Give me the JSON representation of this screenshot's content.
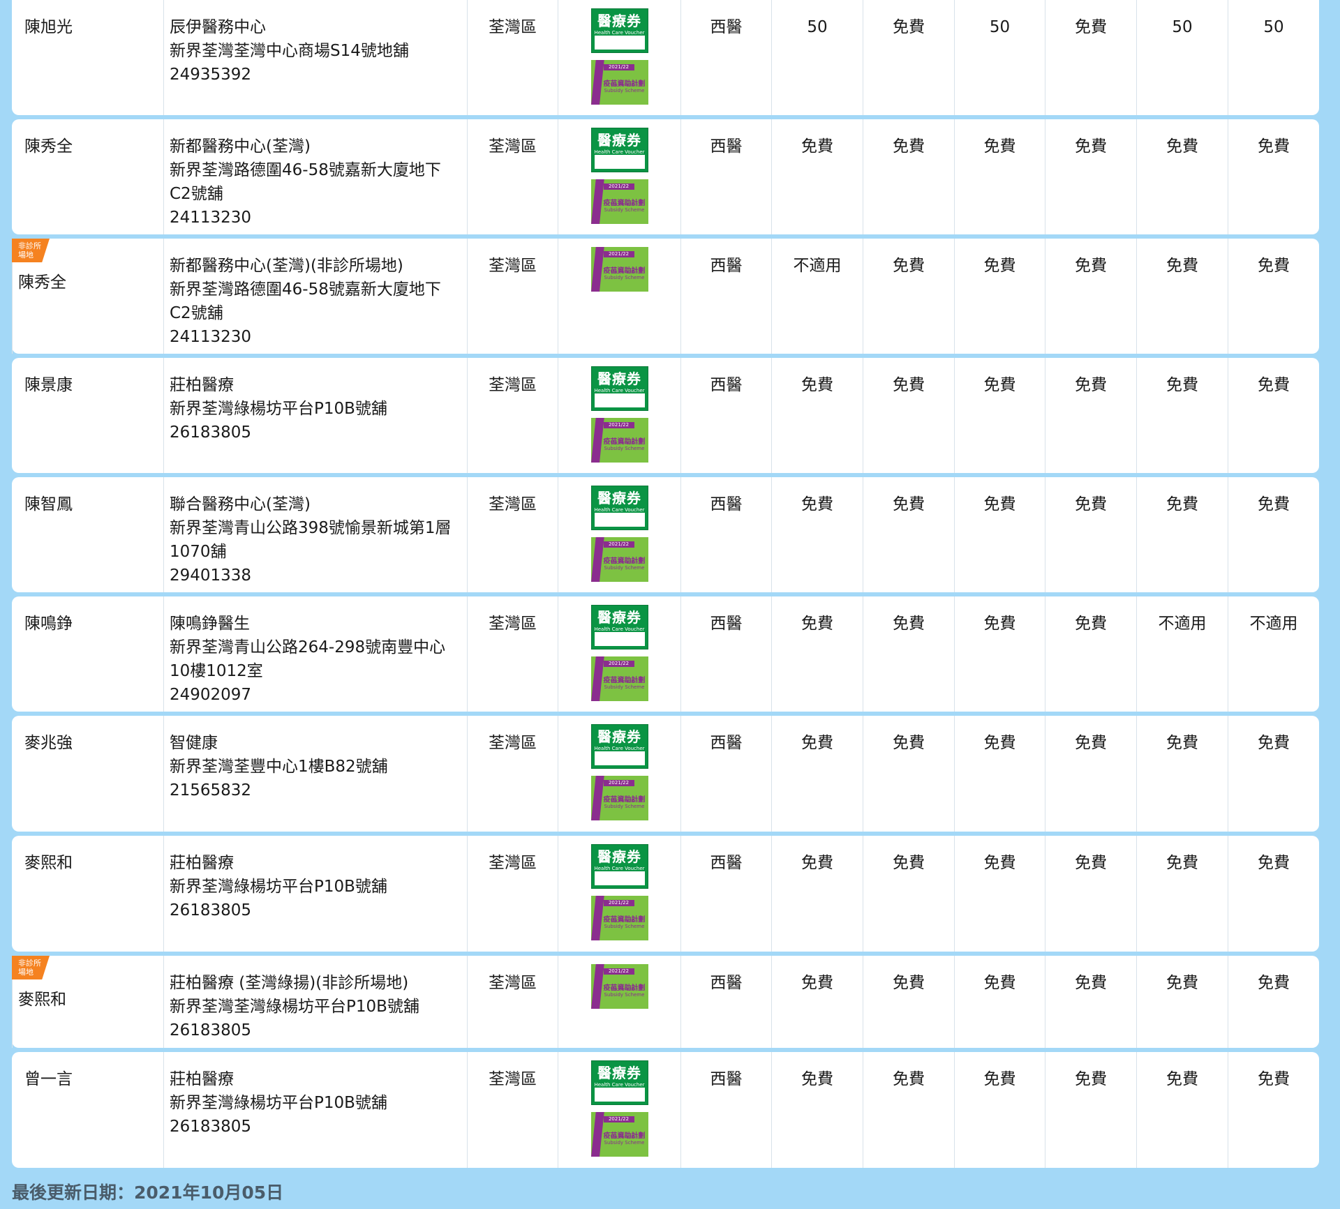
{
  "labels": {
    "hcv_title": "醫療券",
    "hcv_sub": "Health Care Voucher",
    "vss_year": "2021/22",
    "vss_title": "疫苗資助計劃",
    "vss_sub1": "Vaccination",
    "vss_sub2": "Subsidy Scheme",
    "badge_l1": "非診所",
    "badge_l2": "場地"
  },
  "rows": [
    {
      "doctor": "陳旭光",
      "clinic": [
        "辰伊醫務中心",
        "新界荃灣荃灣中心商場S14號地舖",
        "24935392"
      ],
      "district": "荃灣區",
      "type": "西醫",
      "vals": [
        "50",
        "免費",
        "50",
        "免費",
        "50",
        "50"
      ],
      "hcv": true,
      "nonclinic": false
    },
    {
      "doctor": "陳秀全",
      "clinic": [
        "新都醫務中心(荃灣)",
        "新界荃灣路德圍46-58號嘉新大廈地下",
        "C2號舖",
        "24113230"
      ],
      "district": "荃灣區",
      "type": "西醫",
      "vals": [
        "免費",
        "免費",
        "免費",
        "免費",
        "免費",
        "免費"
      ],
      "hcv": true,
      "nonclinic": false
    },
    {
      "doctor": "陳秀全",
      "clinic": [
        "新都醫務中心(荃灣)(非診所場地)",
        "新界荃灣路德圍46-58號嘉新大廈地下",
        "C2號舖",
        "24113230"
      ],
      "district": "荃灣區",
      "type": "西醫",
      "vals": [
        "不適用",
        "免費",
        "免費",
        "免費",
        "免費",
        "免費"
      ],
      "hcv": false,
      "nonclinic": true
    },
    {
      "doctor": "陳景康",
      "clinic": [
        "莊柏醫療",
        "新界荃灣綠楊坊平台P10B號舖",
        "26183805"
      ],
      "district": "荃灣區",
      "type": "西醫",
      "vals": [
        "免費",
        "免費",
        "免費",
        "免費",
        "免費",
        "免費"
      ],
      "hcv": true,
      "nonclinic": false
    },
    {
      "doctor": "陳智鳳",
      "clinic": [
        "聯合醫務中心(荃灣)",
        "新界荃灣青山公路398號愉景新城第1層",
        "1070舖",
        "29401338"
      ],
      "district": "荃灣區",
      "type": "西醫",
      "vals": [
        "免費",
        "免費",
        "免費",
        "免費",
        "免費",
        "免費"
      ],
      "hcv": true,
      "nonclinic": false
    },
    {
      "doctor": "陳鳴錚",
      "clinic": [
        "陳鳴錚醫生",
        "新界荃灣青山公路264-298號南豐中心",
        "10樓1012室",
        "24902097"
      ],
      "district": "荃灣區",
      "type": "西醫",
      "vals": [
        "免費",
        "免費",
        "免費",
        "免費",
        "不適用",
        "不適用"
      ],
      "hcv": true,
      "nonclinic": false
    },
    {
      "doctor": "麥兆強",
      "clinic": [
        "智健康",
        "新界荃灣荃豐中心1樓B82號舖",
        "21565832"
      ],
      "district": "荃灣區",
      "type": "西醫",
      "vals": [
        "免費",
        "免費",
        "免費",
        "免費",
        "免費",
        "免費"
      ],
      "hcv": true,
      "nonclinic": false
    },
    {
      "doctor": "麥熙和",
      "clinic": [
        "莊柏醫療",
        "新界荃灣綠楊坊平台P10B號舖",
        "26183805"
      ],
      "district": "荃灣區",
      "type": "西醫",
      "vals": [
        "免費",
        "免費",
        "免費",
        "免費",
        "免費",
        "免費"
      ],
      "hcv": true,
      "nonclinic": false
    },
    {
      "doctor": "麥熙和",
      "clinic": [
        "莊柏醫療 (荃灣綠揚)(非診所場地)",
        "新界荃灣荃灣綠楊坊平台P10B號舖",
        "26183805"
      ],
      "district": "荃灣區",
      "type": "西醫",
      "vals": [
        "免費",
        "免費",
        "免費",
        "免費",
        "免費",
        "免費"
      ],
      "hcv": false,
      "nonclinic": true
    },
    {
      "doctor": "曾一言",
      "clinic": [
        "莊柏醫療",
        "新界荃灣綠楊坊平台P10B號舖",
        "26183805"
      ],
      "district": "荃灣區",
      "type": "西醫",
      "vals": [
        "免費",
        "免費",
        "免費",
        "免費",
        "免費",
        "免費"
      ],
      "hcv": true,
      "nonclinic": false
    }
  ],
  "footer": "最後更新日期：2021年10月05日"
}
